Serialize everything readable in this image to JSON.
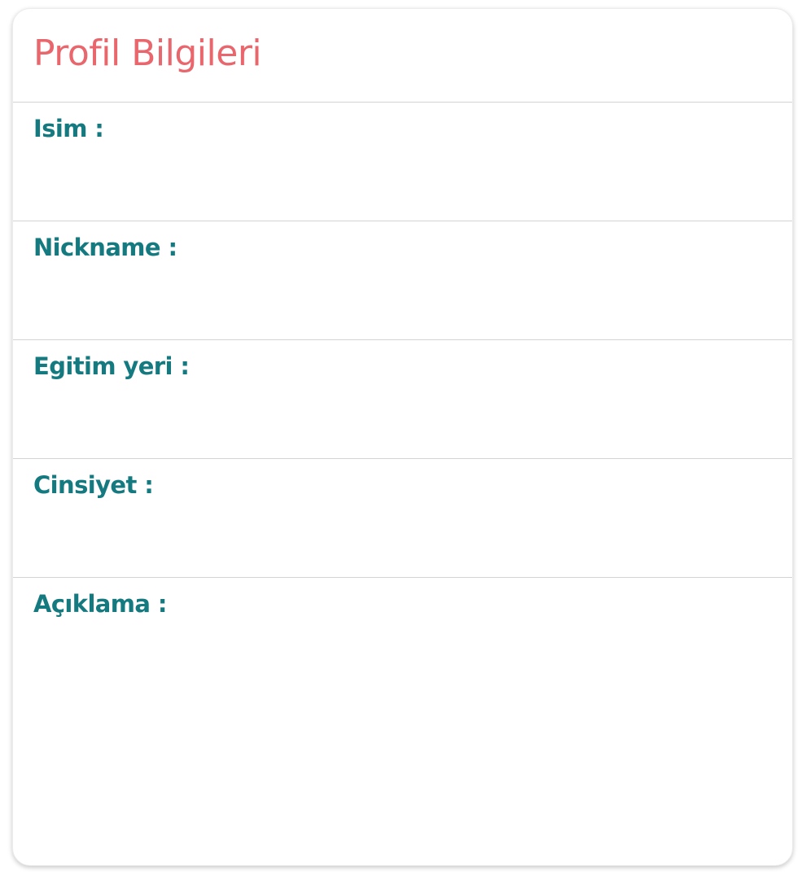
{
  "profile": {
    "title": "Profil Bilgileri",
    "fields": [
      {
        "label": "Isim :",
        "value": ""
      },
      {
        "label": "Nickname :",
        "value": ""
      },
      {
        "label": "Egitim yeri :",
        "value": ""
      },
      {
        "label": "Cinsiyet :",
        "value": ""
      },
      {
        "label": "Açıklama :",
        "value": ""
      }
    ]
  },
  "colors": {
    "title": "#e9666c",
    "label": "#147a80",
    "divider": "#d3d3d3",
    "background": "#ffffff"
  }
}
